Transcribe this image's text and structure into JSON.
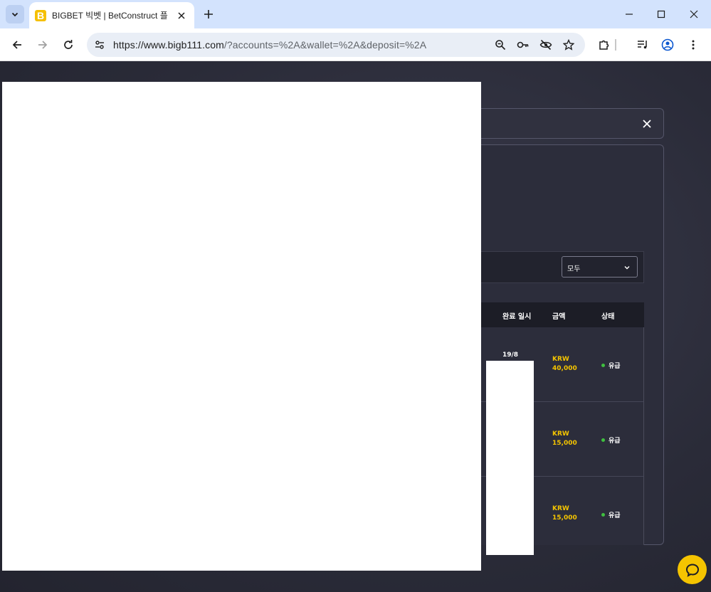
{
  "browser": {
    "tab_title": "BIGBET 빅벳 | BetConstruct 플",
    "favicon_letter": "B",
    "url_main": "https://www.bigb111.com",
    "url_rest": "/?accounts=%2A&wallet=%2A&deposit=%2A",
    "accent": "#d3e3fd"
  },
  "filter": {
    "selected": "모두"
  },
  "table": {
    "headers": {
      "completed": "완료 일시",
      "amount": "금액",
      "status": "상태"
    },
    "rows": [
      {
        "date": "19/8",
        "currency": "KRW",
        "amount": "40,000",
        "status": "유급"
      },
      {
        "date": "",
        "currency": "KRW",
        "amount": "15,000",
        "status": "유급"
      },
      {
        "date": "",
        "currency": "KRW",
        "amount": "15,000",
        "status": "유급"
      }
    ]
  },
  "colors": {
    "amount": "#f4c400",
    "status_dot": "#3fbf3f",
    "chat_button": "#f5c400"
  }
}
